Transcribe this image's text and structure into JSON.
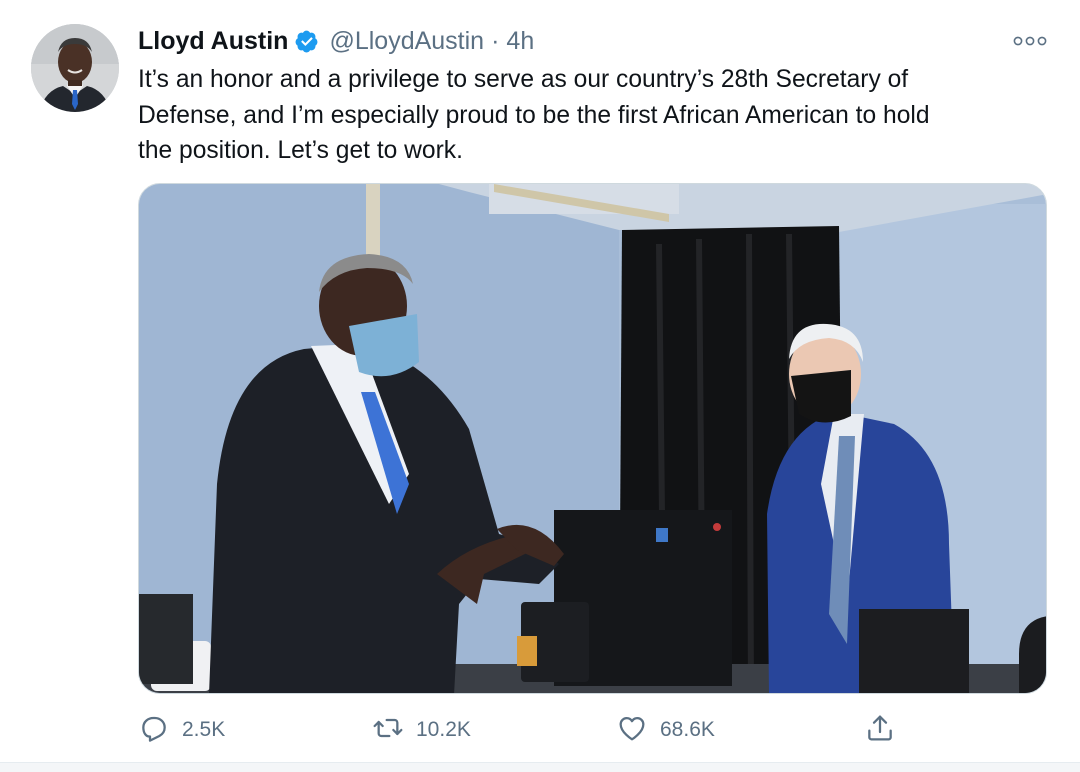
{
  "author": {
    "display_name": "Lloyd Austin",
    "handle": "@LloydAustin",
    "separator": "·",
    "time": "4h",
    "verified_icon": "verified-badge-icon"
  },
  "tweet": {
    "text": "It’s an honor and a privilege to serve as our country’s 28th Secretary of\nDefense, and I’m especially proud to be the first African American to hold\nthe position. Let’s get to work."
  },
  "actions": {
    "reply_count": "2.5K",
    "retweet_count": "10.2K",
    "like_count": "68.6K"
  },
  "colors": {
    "accent": "#1d9bf0",
    "secondary_text": "#5b7083",
    "primary_text": "#0f1419"
  }
}
